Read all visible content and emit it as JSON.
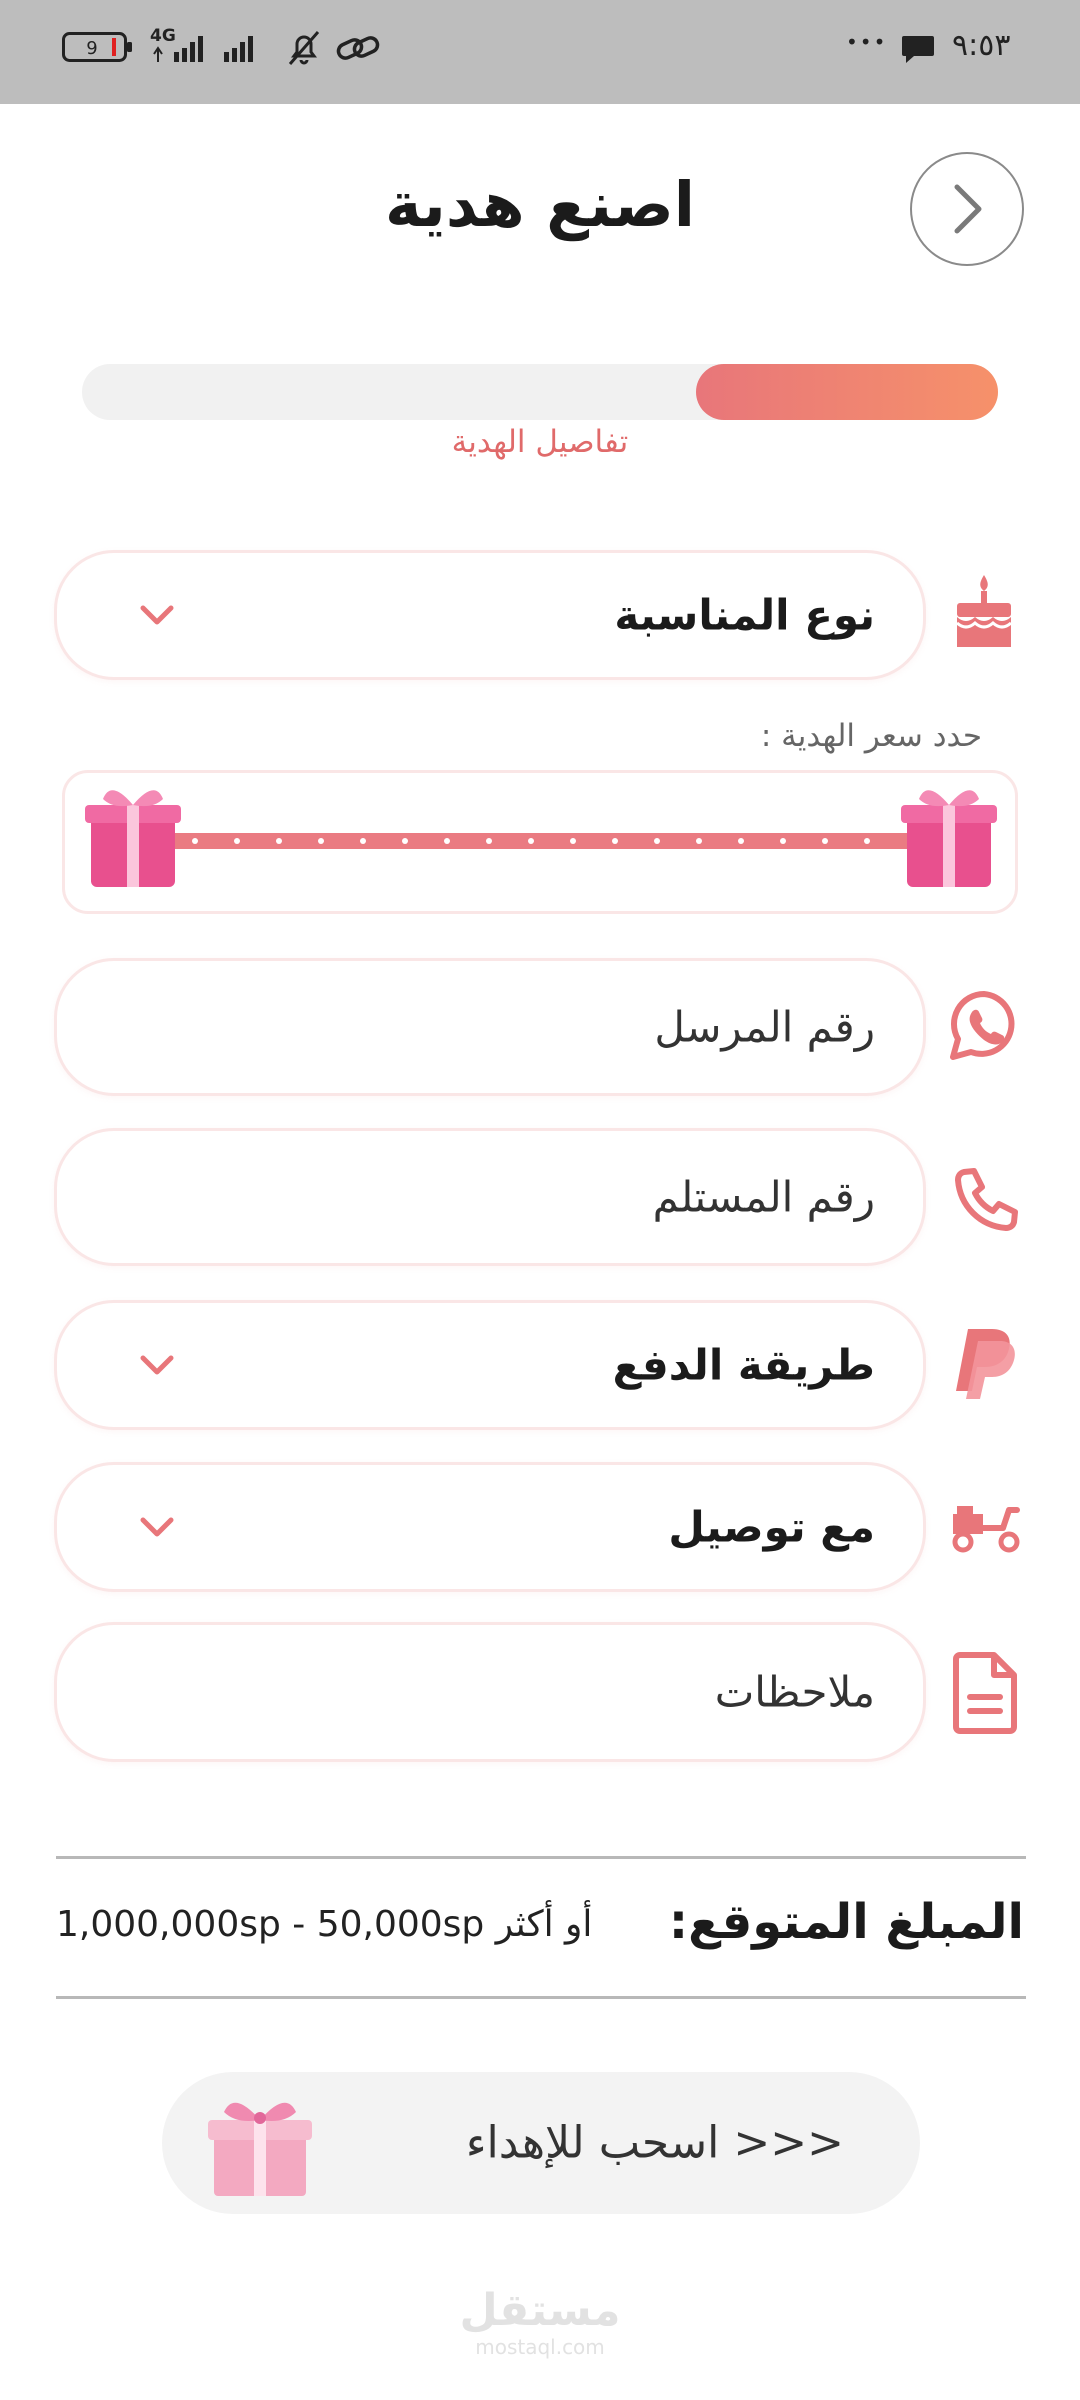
{
  "status_bar": {
    "time": "٩:٥٣",
    "battery": "9",
    "network": "4G",
    "more": "•••"
  },
  "header": {
    "title": "اصنع هدية",
    "back_icon": "chevron-right-icon"
  },
  "progress": {
    "label": "تفاصيل الهدية",
    "value": 0.33
  },
  "fields": {
    "occasion": {
      "label": "نوع المناسبة",
      "icon": "cake-icon"
    },
    "price_label": "حدد سعر الهدية :",
    "sender": {
      "placeholder": "رقم المرسل",
      "icon": "whatsapp-icon"
    },
    "recipient": {
      "placeholder": "رقم المستلم",
      "icon": "phone-icon"
    },
    "payment": {
      "label": "طريقة الدفع",
      "icon": "paypal-icon"
    },
    "delivery": {
      "label": "مع توصيل",
      "icon": "scooter-icon"
    },
    "notes": {
      "placeholder": "ملاحظات",
      "icon": "document-icon"
    }
  },
  "summary": {
    "label": "المبلغ المتوقع:",
    "value": "1,000,000sp - 50,000sp أو أكثر"
  },
  "swipe": {
    "label": "<<< اسحب للإهداء"
  },
  "watermark": {
    "brand": "مستقل",
    "domain": "mostaql.com"
  },
  "colors": {
    "accent": "#e8767a",
    "accent_end": "#f6916a",
    "field_border": "#fae6e6",
    "status_bar": "#bdbdbd"
  }
}
